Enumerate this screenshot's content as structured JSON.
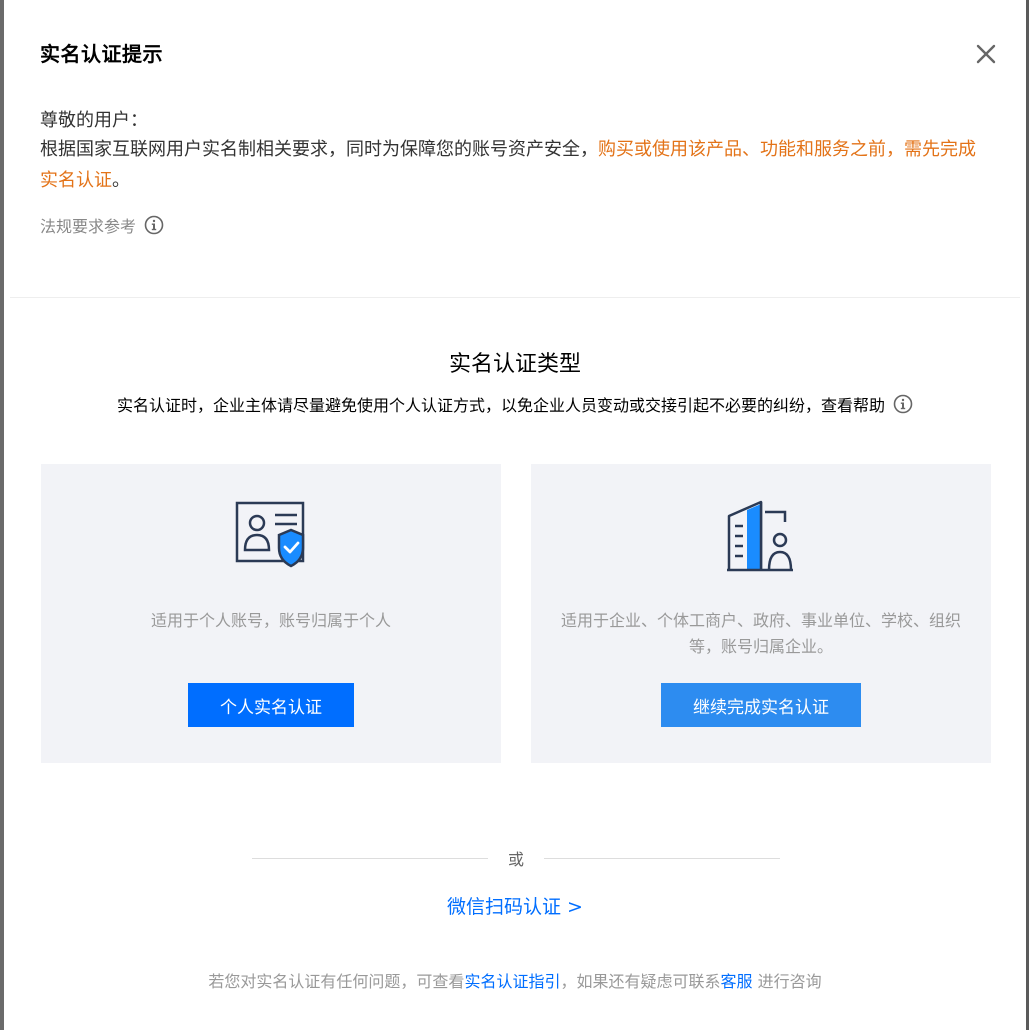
{
  "dialog": {
    "title": "实名认证提示",
    "greeting": "尊敬的用户：",
    "notice_normal": "根据国家互联网用户实名制相关要求，同时为保障您的账号资产安全，",
    "notice_warning": "购买或使用该产品、功能和服务之前，需先完成实名认证",
    "notice_end": "。",
    "law_reference": "法规要求参考"
  },
  "verification": {
    "title": "实名认证类型",
    "description": "实名认证时，企业主体请尽量避免使用个人认证方式，以免企业人员变动或交接引起不必要的纠纷，查看帮助"
  },
  "cards": {
    "personal": {
      "icon": "id-card-shield-icon",
      "description": "适用于个人账号，账号归属于个人",
      "button_label": "个人实名认证"
    },
    "enterprise": {
      "icon": "building-person-icon",
      "description": "适用于企业、个体工商户、政府、事业单位、学校、组织等，账号归属企业。",
      "button_label": "继续完成实名认证"
    }
  },
  "alternative": {
    "or_label": "或",
    "wechat_link": "微信扫码认证 >"
  },
  "footer": {
    "prefix": "若您对实名认证有任何问题，可查看",
    "guide_link": "实名认证指引",
    "middle": "，如果还有疑虑可联系",
    "service_link": "客服",
    "suffix": " 进行咨询"
  },
  "colors": {
    "primary": "#006eff",
    "primary_light": "#2d8cf0",
    "warning": "#e37318",
    "card_bg": "#f2f3f7"
  }
}
